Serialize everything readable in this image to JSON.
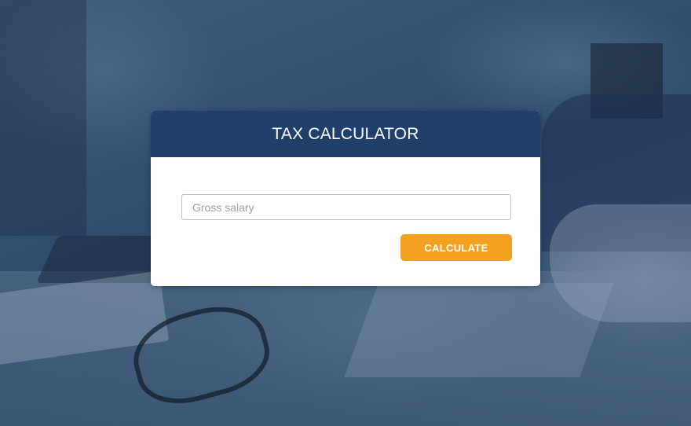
{
  "calculator": {
    "title": "TAX CALCULATOR",
    "gross_salary_input": {
      "value": "",
      "placeholder": "Gross salary"
    },
    "calculate_label": "CALCULATE"
  },
  "colors": {
    "header_background": "#20406b",
    "button_background": "#f3a11e",
    "card_background": "#ffffff",
    "page_overlay": "#2f4a6c"
  }
}
